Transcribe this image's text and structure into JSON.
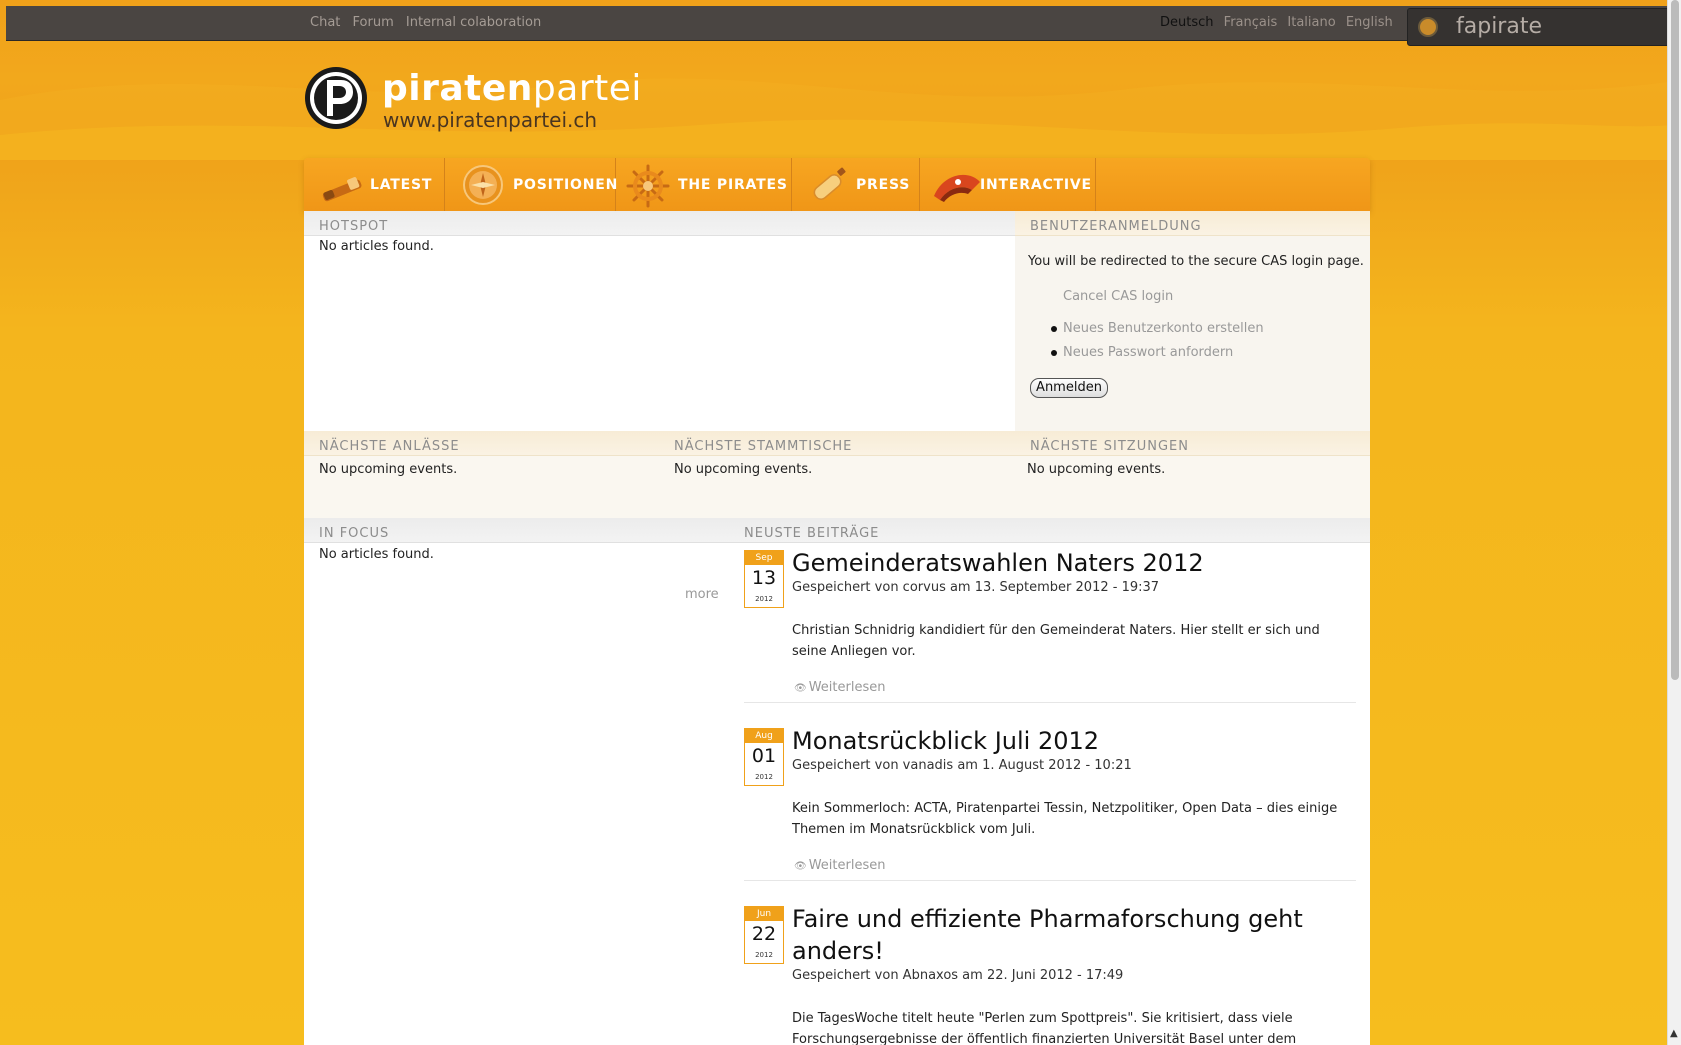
{
  "topbar": {
    "links": [
      "Chat",
      "Forum",
      "Internal colaboration"
    ],
    "languages": [
      {
        "label": "Deutsch",
        "active": true
      },
      {
        "label": "Français",
        "active": false
      },
      {
        "label": "Italiano",
        "active": false
      },
      {
        "label": "English",
        "active": false
      }
    ],
    "user": "fapirate"
  },
  "logo": {
    "name_bold": "piraten",
    "name_light": "partei",
    "url": "www.piratenpartei.ch"
  },
  "nav": [
    {
      "label": "LATEST",
      "icon": "spyglass-icon"
    },
    {
      "label": "POSITIONEN",
      "icon": "compass-icon"
    },
    {
      "label": "THE PIRATES",
      "icon": "ship-wheel-icon"
    },
    {
      "label": "PRESS",
      "icon": "message-bottle-icon"
    },
    {
      "label": "INTERACTIVE",
      "icon": "pirate-hat-icon"
    }
  ],
  "hotspot": {
    "title": "HOTSPOT",
    "empty": "No articles found."
  },
  "login": {
    "title": "BENUTZERANMELDUNG",
    "message": "You will be redirected to the secure CAS login page.",
    "cancel": "Cancel CAS login",
    "links": [
      "Neues Benutzerkonto erstellen",
      "Neues Passwort anfordern"
    ],
    "button": "Anmelden"
  },
  "events": [
    {
      "title": "NÄCHSTE ANLÄSSE",
      "empty": "No upcoming events."
    },
    {
      "title": "NÄCHSTE STAMMTISCHE",
      "empty": "No upcoming events."
    },
    {
      "title": "NÄCHSTE SITZUNGEN",
      "empty": "No upcoming events."
    }
  ],
  "focus": {
    "title": "IN FOCUS",
    "empty": "No articles found.",
    "more": "more"
  },
  "latest": {
    "title": "NEUSTE BEITRÄGE",
    "posts": [
      {
        "month": "Sep",
        "day": "13",
        "year": "2012",
        "title": "Gemeinderatswahlen Naters 2012",
        "meta": "Gespeichert von corvus am 13. September 2012 - 19:37",
        "teaser": "Christian Schnidrig kandidiert für den Gemeinderat Naters. Hier stellt er sich und seine Anliegen vor.",
        "more": "Weiterlesen"
      },
      {
        "month": "Aug",
        "day": "01",
        "year": "2012",
        "title": "Monatsrückblick Juli 2012",
        "meta": "Gespeichert von vanadis am 1. August 2012 - 10:21",
        "teaser": "Kein Sommerloch: ACTA, Piratenpartei Tessin, Netzpolitiker, Open Data – dies einige Themen im Monatsrückblick vom Juli.",
        "more": "Weiterlesen"
      },
      {
        "month": "Jun",
        "day": "22",
        "year": "2012",
        "title": "Faire und effiziente Pharmaforschung geht anders!",
        "meta": "Gespeichert von Abnaxos am 22. Juni 2012 - 17:49",
        "teaser": "Die TagesWoche titelt heute \"Perlen zum Spottpreis\". Sie kritisiert, dass viele Forschungsergebnisse der öffentlich finanzierten Universität Basel unter dem eigentlichen",
        "more": ""
      }
    ]
  },
  "colors": {
    "accent": "#f09617",
    "topbar": "#4a4542",
    "date_accent": "#f0a11a"
  }
}
